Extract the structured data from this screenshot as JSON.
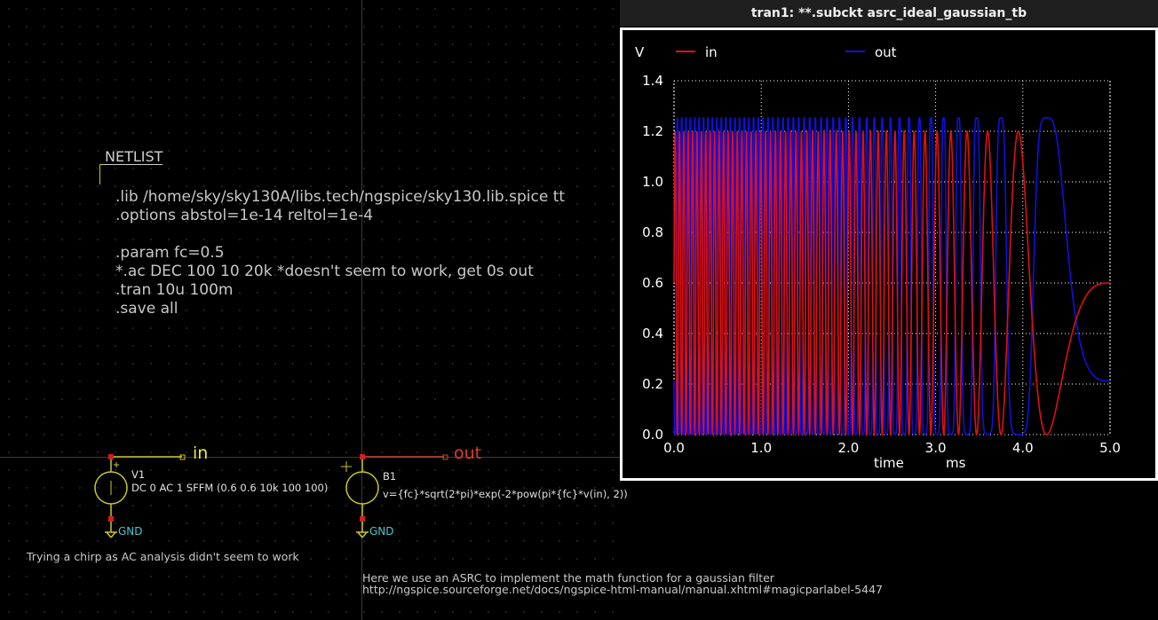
{
  "schematic": {
    "netlist_title": "NETLIST",
    "netlist_lines": [
      ".lib /home/sky/sky130A/libs.tech/ngspice/sky130.lib.spice tt",
      ".options abstol=1e-14 reltol=1e-4",
      "",
      ".param fc=0.5",
      "*.ac DEC 100 10 20k *doesn't seem to work, get 0s out",
      ".tran 10u 100m",
      ".save all"
    ],
    "v1": {
      "name": "V1",
      "value": "DC 0 AC 1 SFFM (0.6 0.6 10k 100 100)"
    },
    "b1": {
      "name": "B1",
      "value": "v={fc}*sqrt(2*pi)*exp(-2*pow(pi*{fc}*v(in), 2))"
    },
    "gnd1": "GND",
    "gnd2": "GND",
    "net_in": "in",
    "net_out": "out",
    "comment_chirp": "Trying a chirp as AC analysis didn't seem to work",
    "comment_asrc_1": "Here we use an ASRC to implement the math function for a gaussian filter",
    "comment_asrc_2": "http://ngspice.sourceforge.net/docs/ngspice-html-manual/manual.xhtml#magicparlabel-5447"
  },
  "plot": {
    "window_title": "tran1: **.subckt asrc_ideal_gaussian_tb",
    "y_unit": "V",
    "x_label": "time",
    "x_unit": "ms",
    "legend": [
      {
        "name": "in",
        "color": "#e01010"
      },
      {
        "name": "out",
        "color": "#1010e0"
      }
    ]
  },
  "chart_data": {
    "type": "line",
    "x_tick_labels": [
      "0.0",
      "1.0",
      "2.0",
      "3.0",
      "4.0",
      "5.0"
    ],
    "y_tick_labels": [
      "0.0",
      "0.2",
      "0.4",
      "0.6",
      "0.8",
      "1.0",
      "1.2",
      "1.4"
    ],
    "xlim": [
      0,
      5
    ],
    "ylim": [
      0,
      1.4
    ],
    "grid": true,
    "legend_placement": "top",
    "series": [
      {
        "name": "in",
        "color": "#e01010",
        "description_formula": "0.6 + 0.6*sin(2*pi*10k*t + 100*sin(2*pi*100*t))"
      },
      {
        "name": "out",
        "color": "#1010e0",
        "description_formula": "0.5*sqrt(2*pi)*exp(-2*(pi*0.5*v(in))^2)"
      }
    ]
  }
}
